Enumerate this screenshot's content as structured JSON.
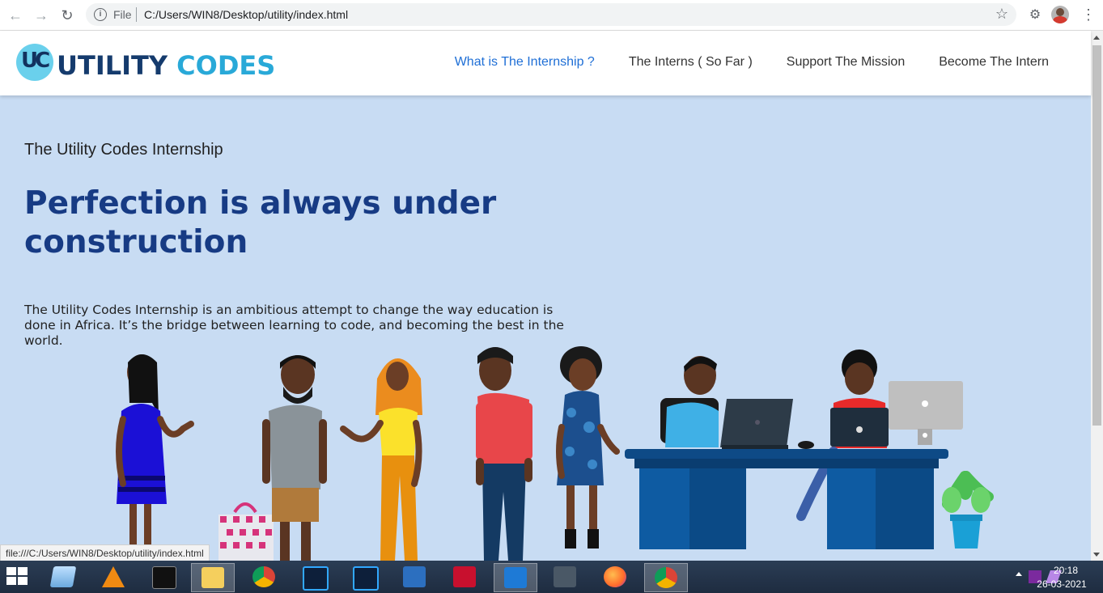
{
  "browser": {
    "scheme_label": "File",
    "url": "C:/Users/WIN8/Desktop/utility/index.html",
    "status_url": "file:///C:/Users/WIN8/Desktop/utility/index.html"
  },
  "site": {
    "logo_mark": "UC",
    "logo_word_1": "UTILITY",
    "logo_word_2": "CODES",
    "nav": [
      {
        "label": "What is The Internship ?",
        "active": true
      },
      {
        "label": "The Interns ( So Far )",
        "active": false
      },
      {
        "label": "Support The Mission",
        "active": false
      },
      {
        "label": "Become The Intern",
        "active": false
      }
    ]
  },
  "hero": {
    "kicker": "The Utility Codes Internship",
    "headline": "Perfection is always under construction",
    "lede": "The Utility Codes Internship is an ambitious attempt to change the way education is done in Africa. It’s the bridge between learning to code, and becoming the best in the world."
  },
  "taskbar": {
    "apps": [
      "windows-explorer-icon",
      "vlc-icon",
      "cmd-icon",
      "file-explorer-icon",
      "chrome-icon",
      "photoshop-icon",
      "photoshop-icon-2",
      "typing-app-icon",
      "pdf-reader-icon",
      "vscode-icon",
      "sql-icon",
      "firefox-icon",
      "chrome-canary-icon"
    ],
    "clock_time": "20:18",
    "clock_date": "26-03-2021"
  },
  "colors": {
    "hero_bg": "#c8dcf3",
    "headline": "#173b84",
    "nav_active": "#1f6fd6",
    "logo_dark": "#153b6d",
    "logo_light": "#29a9d8"
  }
}
